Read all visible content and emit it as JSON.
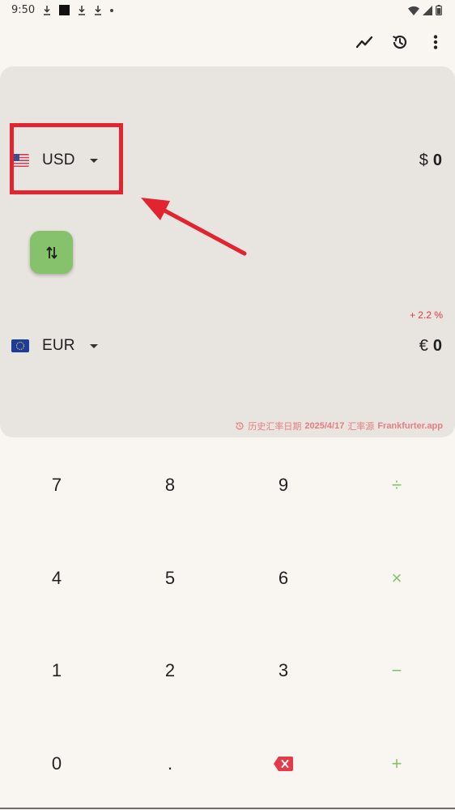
{
  "status_bar": {
    "time": "9:50"
  },
  "top_actions": {
    "chart_icon": "trend-chart-icon",
    "history_icon": "history-icon",
    "menu_icon": "more-vert-icon"
  },
  "source_currency": {
    "code": "USD",
    "symbol": "$",
    "amount": "0",
    "flag": "us-flag-icon"
  },
  "target_currency": {
    "code": "EUR",
    "symbol": "€",
    "amount": "0",
    "flag": "eu-flag-icon"
  },
  "rate_change": "+ 2.2 %",
  "rate_source": {
    "prefix": "历史汇率日期",
    "date": "2025/4/17",
    "middle": "汇率源",
    "source": "Frankfurter.app"
  },
  "keypad": {
    "keys": [
      [
        "7",
        "8",
        "9",
        "÷"
      ],
      [
        "4",
        "5",
        "6",
        "×"
      ],
      [
        "1",
        "2",
        "3",
        "−"
      ],
      [
        "0",
        ".",
        "",
        "+"
      ]
    ]
  },
  "colors": {
    "accent_green": "#86c16b",
    "highlight_red": "#e2242e",
    "card_bg": "#e8e4df",
    "page_bg": "#f9f6f1"
  }
}
